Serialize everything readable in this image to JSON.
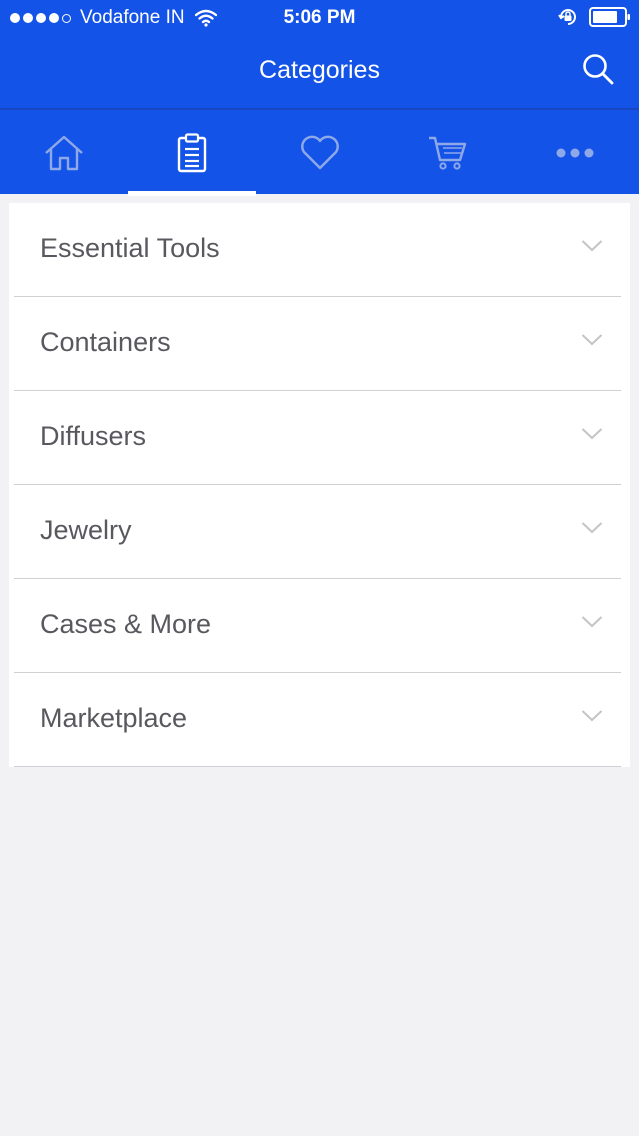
{
  "status_bar": {
    "carrier": "Vodafone IN",
    "time": "5:06 PM"
  },
  "nav": {
    "title": "Categories"
  },
  "tabs": [
    {
      "name": "home-icon",
      "active": false
    },
    {
      "name": "clipboard-icon",
      "active": true
    },
    {
      "name": "heart-icon",
      "active": false
    },
    {
      "name": "cart-icon",
      "active": false
    },
    {
      "name": "more-icon",
      "active": false
    }
  ],
  "categories": [
    {
      "label": "Essential Tools"
    },
    {
      "label": "Containers"
    },
    {
      "label": "Diffusers"
    },
    {
      "label": "Jewelry"
    },
    {
      "label": "Cases & More"
    },
    {
      "label": "Marketplace"
    }
  ],
  "colors": {
    "brand": "#1453e8",
    "inactive_icon": "#8fa8e8",
    "text": "#58585e",
    "background": "#f2f2f4"
  }
}
